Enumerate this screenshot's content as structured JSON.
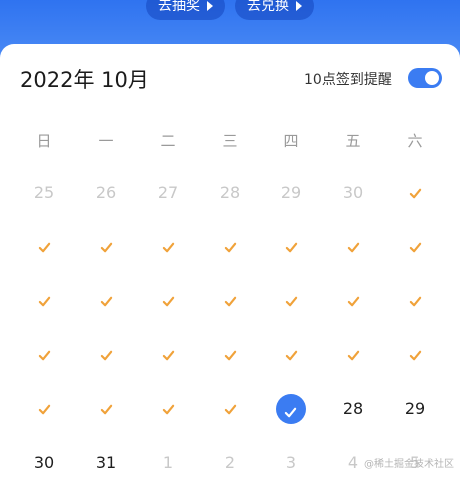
{
  "header": {
    "lottery_label": "去抽奖",
    "exchange_label": "去兑换"
  },
  "calendar": {
    "title": "2022年 10月",
    "reminder_label": "10点签到提醒",
    "reminder_on": true,
    "weekdays": [
      "日",
      "一",
      "二",
      "三",
      "四",
      "五",
      "六"
    ],
    "rows": [
      [
        "25",
        "26",
        "27",
        "28",
        "29",
        "30",
        "✓"
      ],
      [
        "✓",
        "✓",
        "✓",
        "✓",
        "✓",
        "✓",
        "✓"
      ],
      [
        "✓",
        "✓",
        "✓",
        "✓",
        "✓",
        "✓",
        "✓"
      ],
      [
        "✓",
        "✓",
        "✓",
        "✓",
        "✓",
        "✓",
        "✓"
      ],
      [
        "✓",
        "✓",
        "✓",
        "✓",
        "today",
        "28",
        "29"
      ],
      [
        "30",
        "31",
        "1",
        "2",
        "3",
        "4",
        "5"
      ]
    ]
  },
  "watermark": "@稀土掘金技术社区",
  "colors": {
    "accent": "#3b7cf2",
    "check": "#f0a23a",
    "muted": "#c8c8c8"
  }
}
